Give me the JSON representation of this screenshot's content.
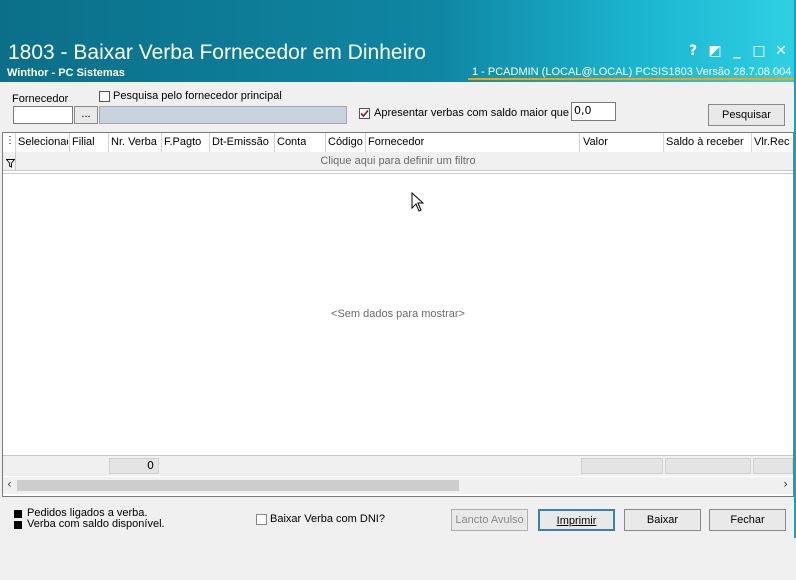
{
  "window": {
    "title": "1803 - Baixar Verba Fornecedor em Dinheiro",
    "subtitle": "Winthor - PC Sistemas",
    "session": "1 - PCADMIN (LOCAL@LOCAL)  PCSIS1803  Versão  28.7.08.004",
    "buttons": {
      "help": "?",
      "restore_alt": "◩",
      "minimize": "_",
      "maximize": "□",
      "close": "✕"
    }
  },
  "filters": {
    "fornecedor_label": "Fornecedor",
    "fornecedor_code": "",
    "fornecedor_name": "",
    "lookup_button": "...",
    "pesquisa_principal_label": "Pesquisa pelo fornecedor principal",
    "pesquisa_principal_checked": false,
    "apresentar_label": "Apresentar verbas com saldo maior que",
    "apresentar_checked": true,
    "saldo_value": "0,0",
    "pesquisar_button": "Pesquisar"
  },
  "grid": {
    "columns": [
      "Selecionado",
      "Filial",
      "Nr. Verba",
      "F.Pagto",
      "Dt-Emissão",
      "Conta",
      "Código",
      "Fornecedor",
      "Valor",
      "Saldo à receber",
      "Vlr.Rec"
    ],
    "filter_prompt": "Clique aqui para definir um filtro",
    "empty_text": "<Sem dados para mostrar>",
    "footer_count": "0"
  },
  "legend": {
    "item1": "Pedidos ligados a verba.",
    "item2": "Verba com saldo disponível."
  },
  "actions": {
    "baixar_dni_label": "Baixar Verba com DNI?",
    "baixar_dni_checked": false,
    "lancto_avulso": "Lancto Avulso",
    "imprimir": "Imprimir",
    "baixar": "Baixar",
    "fechar": "Fechar"
  },
  "colors": {
    "titlebar_start": "#0b6f88",
    "titlebar_end": "#2fd0e4",
    "session_underline": "#ffa000",
    "check_mark": "#8b1a1a"
  }
}
